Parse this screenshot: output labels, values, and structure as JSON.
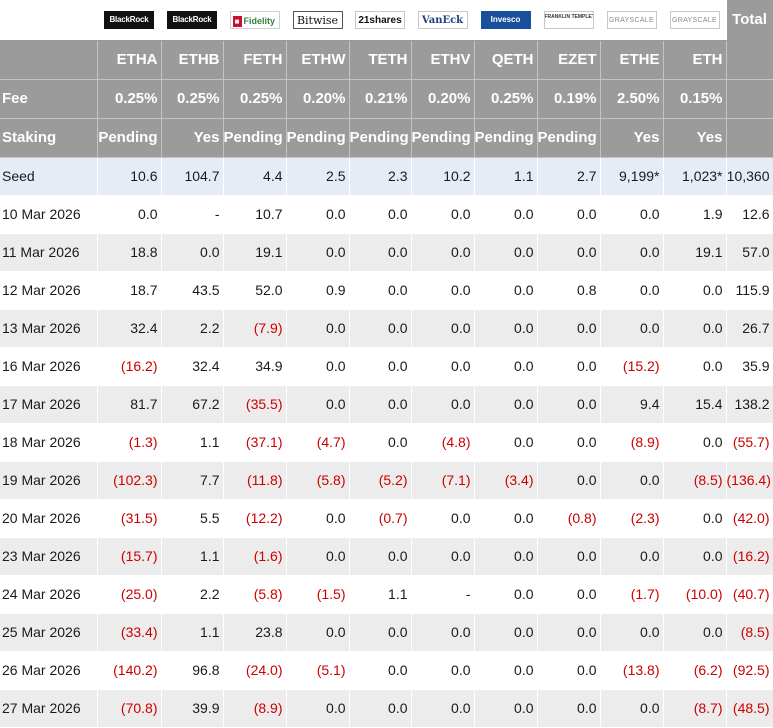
{
  "logos": [
    {
      "text": "BlackRock",
      "icon": "blackrock-logo-icon"
    },
    {
      "text": "BlackRock",
      "icon": "blackrock-logo-icon"
    },
    {
      "text": "Fidelity",
      "icon": "fidelity-logo-icon"
    },
    {
      "text": "Bitwise",
      "icon": "bitwise-logo-icon"
    },
    {
      "text": "21shares",
      "icon": "21shares-logo-icon"
    },
    {
      "text": "VanEck",
      "icon": "vaneck-logo-icon"
    },
    {
      "text": "Invesco",
      "icon": "invesco-logo-icon"
    },
    {
      "text": "FRANKLIN TEMPLETON",
      "icon": "franklin-templeton-logo-icon"
    },
    {
      "text": "GRAYSCALE",
      "icon": "grayscale-logo-icon"
    },
    {
      "text": "GRAYSCALE",
      "icon": "grayscale-logo-icon"
    }
  ],
  "total_label": "Total",
  "tickers": [
    "ETHA",
    "ETHB",
    "FETH",
    "ETHW",
    "TETH",
    "ETHV",
    "QETH",
    "EZET",
    "ETHE",
    "ETH"
  ],
  "fee": {
    "label": "Fee",
    "values": [
      "0.25%",
      "0.25%",
      "0.25%",
      "0.20%",
      "0.21%",
      "0.20%",
      "0.25%",
      "0.19%",
      "2.50%",
      "0.15%"
    ]
  },
  "staking": {
    "label": "Staking",
    "values": [
      "Pending",
      "Yes",
      "Pending",
      "Pending",
      "Pending",
      "Pending",
      "Pending",
      "Pending",
      "Yes",
      "Yes"
    ]
  },
  "rows": [
    {
      "label": "Seed",
      "values": [
        "10.6",
        "104.7",
        "4.4",
        "2.5",
        "2.3",
        "10.2",
        "1.1",
        "2.7",
        "9,199*",
        "1,023*"
      ],
      "total": "10,360"
    },
    {
      "label": "10 Mar 2026",
      "values": [
        "0.0",
        "-",
        "10.7",
        "0.0",
        "0.0",
        "0.0",
        "0.0",
        "0.0",
        "0.0",
        "1.9"
      ],
      "total": "12.6"
    },
    {
      "label": "11 Mar 2026",
      "values": [
        "18.8",
        "0.0",
        "19.1",
        "0.0",
        "0.0",
        "0.0",
        "0.0",
        "0.0",
        "0.0",
        "19.1"
      ],
      "total": "57.0"
    },
    {
      "label": "12 Mar 2026",
      "values": [
        "18.7",
        "43.5",
        "52.0",
        "0.9",
        "0.0",
        "0.0",
        "0.0",
        "0.8",
        "0.0",
        "0.0"
      ],
      "total": "115.9"
    },
    {
      "label": "13 Mar 2026",
      "values": [
        "32.4",
        "2.2",
        "(7.9)",
        "0.0",
        "0.0",
        "0.0",
        "0.0",
        "0.0",
        "0.0",
        "0.0"
      ],
      "total": "26.7"
    },
    {
      "label": "16 Mar 2026",
      "values": [
        "(16.2)",
        "32.4",
        "34.9",
        "0.0",
        "0.0",
        "0.0",
        "0.0",
        "0.0",
        "(15.2)",
        "0.0"
      ],
      "total": "35.9"
    },
    {
      "label": "17 Mar 2026",
      "values": [
        "81.7",
        "67.2",
        "(35.5)",
        "0.0",
        "0.0",
        "0.0",
        "0.0",
        "0.0",
        "9.4",
        "15.4"
      ],
      "total": "138.2"
    },
    {
      "label": "18 Mar 2026",
      "values": [
        "(1.3)",
        "1.1",
        "(37.1)",
        "(4.7)",
        "0.0",
        "(4.8)",
        "0.0",
        "0.0",
        "(8.9)",
        "0.0"
      ],
      "total": "(55.7)"
    },
    {
      "label": "19 Mar 2026",
      "values": [
        "(102.3)",
        "7.7",
        "(11.8)",
        "(5.8)",
        "(5.2)",
        "(7.1)",
        "(3.4)",
        "0.0",
        "0.0",
        "(8.5)"
      ],
      "total": "(136.4)"
    },
    {
      "label": "20 Mar 2026",
      "values": [
        "(31.5)",
        "5.5",
        "(12.2)",
        "0.0",
        "(0.7)",
        "0.0",
        "0.0",
        "(0.8)",
        "(2.3)",
        "0.0"
      ],
      "total": "(42.0)"
    },
    {
      "label": "23 Mar 2026",
      "values": [
        "(15.7)",
        "1.1",
        "(1.6)",
        "0.0",
        "0.0",
        "0.0",
        "0.0",
        "0.0",
        "0.0",
        "0.0"
      ],
      "total": "(16.2)"
    },
    {
      "label": "24 Mar 2026",
      "values": [
        "(25.0)",
        "2.2",
        "(5.8)",
        "(1.5)",
        "1.1",
        "-",
        "0.0",
        "0.0",
        "(1.7)",
        "(10.0)"
      ],
      "total": "(40.7)"
    },
    {
      "label": "25 Mar 2026",
      "values": [
        "(33.4)",
        "1.1",
        "23.8",
        "0.0",
        "0.0",
        "0.0",
        "0.0",
        "0.0",
        "0.0",
        "0.0"
      ],
      "total": "(8.5)"
    },
    {
      "label": "26 Mar 2026",
      "values": [
        "(140.2)",
        "96.8",
        "(24.0)",
        "(5.1)",
        "0.0",
        "0.0",
        "0.0",
        "0.0",
        "(13.8)",
        "(6.2)"
      ],
      "total": "(92.5)"
    },
    {
      "label": "27 Mar 2026",
      "values": [
        "(70.8)",
        "39.9",
        "(8.9)",
        "0.0",
        "0.0",
        "0.0",
        "0.0",
        "0.0",
        "0.0",
        "(8.7)"
      ],
      "total": "(48.5)"
    }
  ],
  "colors": {
    "header_bg": "#9b9b9b",
    "negative": "#cc0000",
    "seed_row_bg": "#e6ecf6",
    "alt_row_bg": "#ececec"
  }
}
